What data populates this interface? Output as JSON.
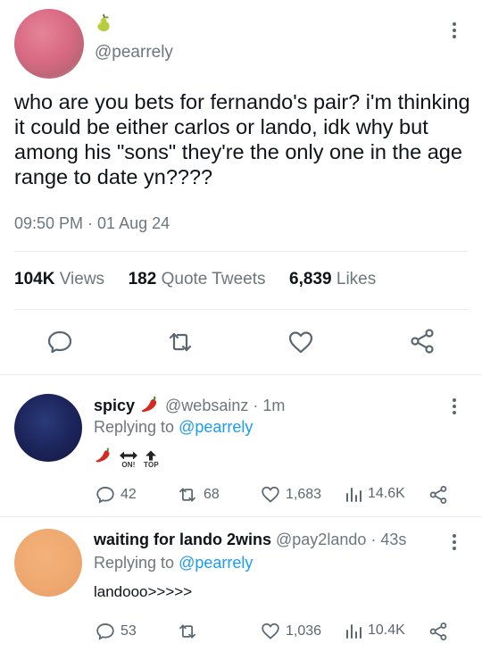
{
  "main_tweet": {
    "handle": "@pearrely",
    "text": "who are you bets for fernando's pair? i'm thinking it could be either carlos or lando, idk why but among his \"sons\" they're the only one in the age range to date yn????",
    "timestamp": "09:50 PM · 01 Aug 24",
    "stats": {
      "views_count": "104K",
      "views_label": "Views",
      "quotes_count": "182",
      "quotes_label": "Quote Tweets",
      "likes_count": "6,839",
      "likes_label": "Likes"
    },
    "icons": {
      "reply": "comment-icon",
      "retweet": "retweet-icon",
      "like": "heart-icon",
      "share": "share-icon"
    }
  },
  "replies": [
    {
      "name": "spicy",
      "handle": "@websainz",
      "time": "· 1m",
      "replying_prefix": "Replying to",
      "replying_to": "@pearrely",
      "emoji_labels": {
        "on": "ON!",
        "top": "TOP"
      },
      "metrics": {
        "replies": "42",
        "retweets": "68",
        "likes": "1,683",
        "views": "14.6K"
      }
    },
    {
      "name": "waiting for lando 2wins",
      "handle": "@pay2lando",
      "time": "· 43s",
      "replying_prefix": "Replying to",
      "replying_to": "@pearrely",
      "body": "landooo>>>>>",
      "metrics": {
        "replies": "53",
        "retweets": "",
        "likes": "1,036",
        "views": "10.4K"
      }
    }
  ],
  "colors": {
    "accent": "#1d9bf0",
    "muted": "#6e767d",
    "divider": "#e6ecf0"
  }
}
